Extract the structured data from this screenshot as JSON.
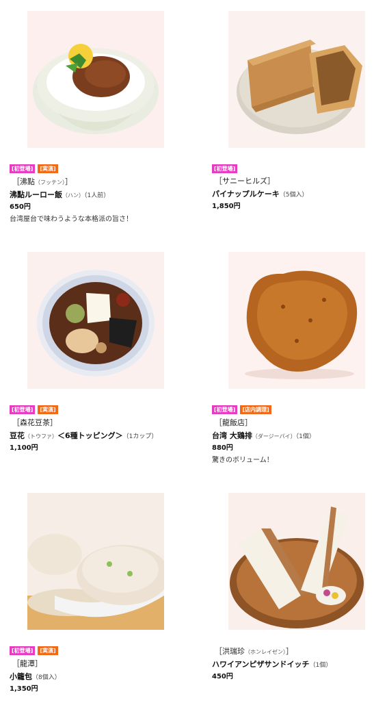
{
  "products": [
    {
      "badges": [
        "[初登場]",
        "[実演]"
      ],
      "shop": "［沸點",
      "shop_reading": "（フッテン）",
      "shop_close": "］",
      "name": "沸點ルーロー飯",
      "name_reading": "（ハン）",
      "quantity": "（1人前）",
      "price": "650円",
      "description": "台湾屋台で味わうような本格派の旨さ！",
      "image_icon": "braised-pork-rice-bowl"
    },
    {
      "badges": [
        "[初登場]"
      ],
      "shop": "［サニーヒルズ］",
      "name": "パイナップルケーキ",
      "quantity": "（5個入）",
      "price": "1,850円",
      "image_icon": "pineapple-cake"
    },
    {
      "badges": [
        "[初登場]",
        "[実演]"
      ],
      "shop": "［森花豆茶］",
      "name": "豆花",
      "name_reading": "（トウファ）",
      "name_extra": "＜6種トッピング＞",
      "quantity": "（1カップ）",
      "price": "1,100円",
      "image_icon": "douhua-bowl"
    },
    {
      "badges": [
        "[初登場]",
        "[店内調理]"
      ],
      "shop": "［龍飯店］",
      "name": "台湾 大鶏排",
      "name_reading": "（ダージーパイ）",
      "quantity": "（1個）",
      "price": "880円",
      "description": "驚きのボリューム！",
      "image_icon": "fried-chicken-cutlet"
    },
    {
      "badges": [
        "[初登場]",
        "[実演]"
      ],
      "shop": "［龍潭］",
      "name": "小籠包",
      "quantity": "（8個入）",
      "price": "1,350円",
      "image_icon": "xiaolongbao"
    },
    {
      "shop": "［洪瑞珍",
      "shop_reading": "（ホンレイゼン）",
      "shop_close": "］",
      "name": "ハワイアンピザサンドイッチ",
      "quantity": "（1個）",
      "price": "450円",
      "image_icon": "sandwich-plate"
    }
  ]
}
